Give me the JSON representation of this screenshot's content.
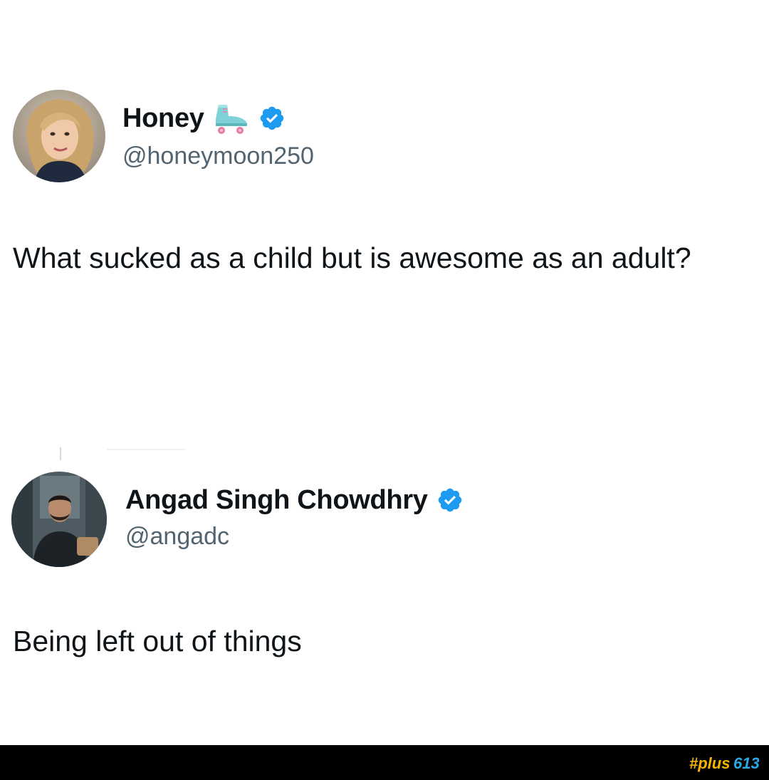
{
  "tweets": [
    {
      "display_name": "Honey",
      "handle": "@honeymoon250",
      "text": "What sucked as a child but is awesome as an adult?",
      "verified": true,
      "name_emoji": "roller-skate-icon"
    },
    {
      "display_name": "Angad Singh Chowdhry",
      "handle": "@angadc",
      "text": "Being left out of things",
      "verified": true
    }
  ],
  "watermark": {
    "text": "#plus613",
    "colors": {
      "primary": "#f7b500",
      "secondary": "#2aa7e6"
    }
  },
  "colors": {
    "verified_badge": "#1d9bf0",
    "handle": "#536471",
    "text": "#0f1419",
    "bottom_bar": "#000000"
  }
}
